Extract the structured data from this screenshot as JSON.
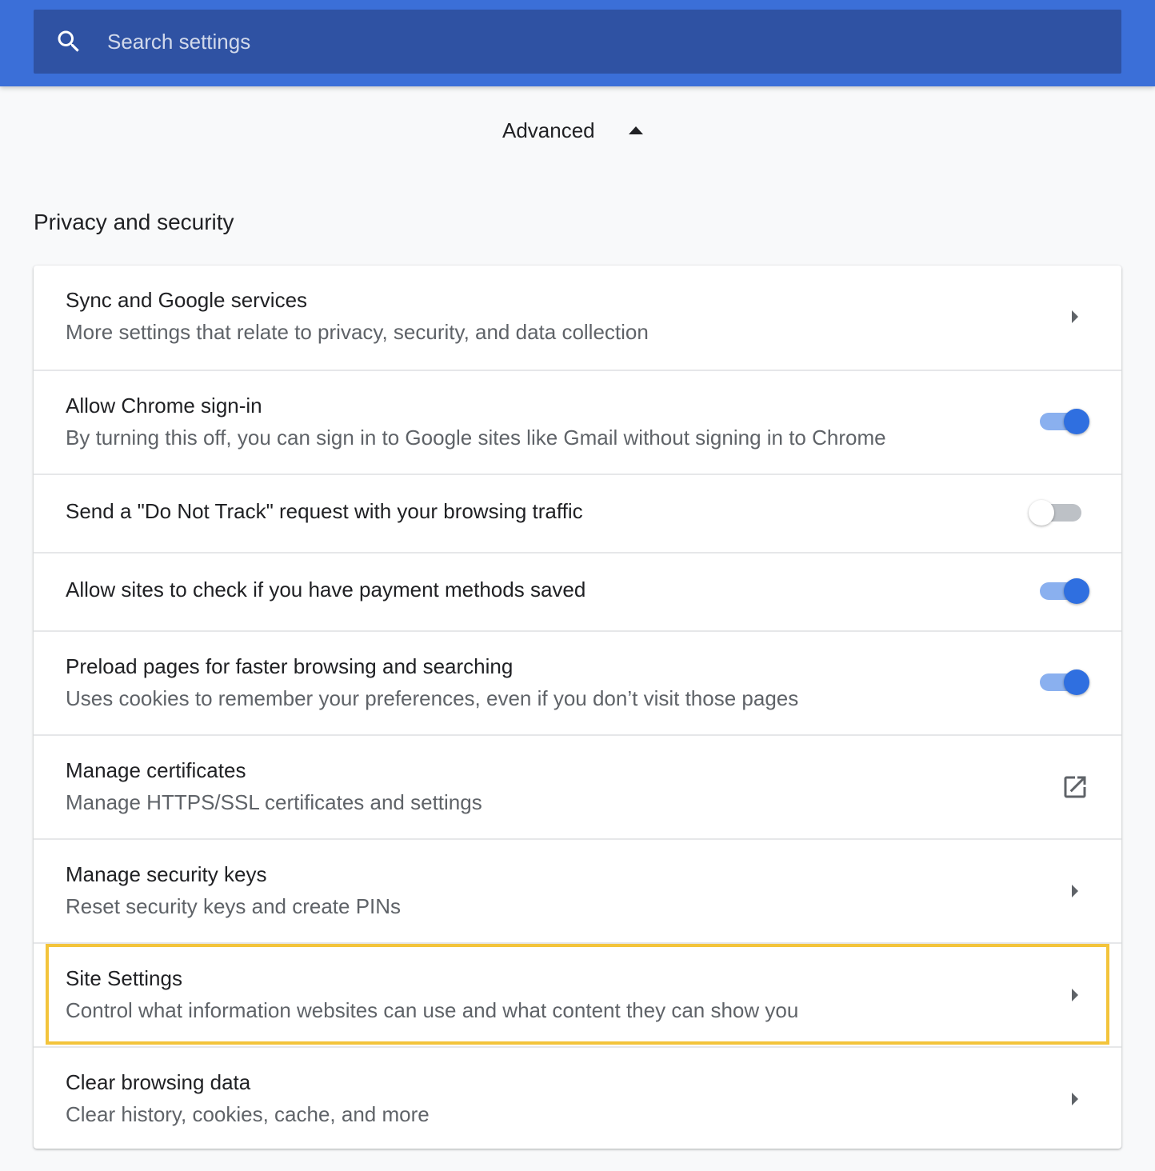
{
  "search": {
    "placeholder": "Search settings"
  },
  "advanced": {
    "label": "Advanced",
    "expanded": true
  },
  "section": {
    "title": "Privacy and security"
  },
  "rows": [
    {
      "title": "Sync and Google services",
      "subtitle": "More settings that relate to privacy, security, and data collection",
      "control": "chevron-right-icon"
    },
    {
      "title": "Allow Chrome sign-in",
      "subtitle": "By turning this off, you can sign in to Google sites like Gmail without signing in to Chrome",
      "control": "toggle",
      "enabled": true
    },
    {
      "title": "Send a \"Do Not Track\" request with your browsing traffic",
      "control": "toggle",
      "enabled": false
    },
    {
      "title": "Allow sites to check if you have payment methods saved",
      "control": "toggle",
      "enabled": true
    },
    {
      "title": "Preload pages for faster browsing and searching",
      "subtitle": "Uses cookies to remember your preferences, even if you don’t visit those pages",
      "control": "toggle",
      "enabled": true
    },
    {
      "title": "Manage certificates",
      "subtitle": "Manage HTTPS/SSL certificates and settings",
      "control": "open-in-new-icon"
    },
    {
      "title": "Manage security keys",
      "subtitle": "Reset security keys and create PINs",
      "control": "chevron-right-icon"
    },
    {
      "title": "Site Settings",
      "subtitle": "Control what information websites can use and what content they can show you",
      "control": "chevron-right-icon",
      "highlighted": true
    },
    {
      "title": "Clear browsing data",
      "subtitle": "Clear history, cookies, cache, and more",
      "control": "chevron-right-icon"
    }
  ],
  "colors": {
    "header": "#3b6fd8",
    "search_box": "#2f52a3",
    "toggle_on": "#2f6fe0",
    "highlight": "#f3c43b"
  }
}
